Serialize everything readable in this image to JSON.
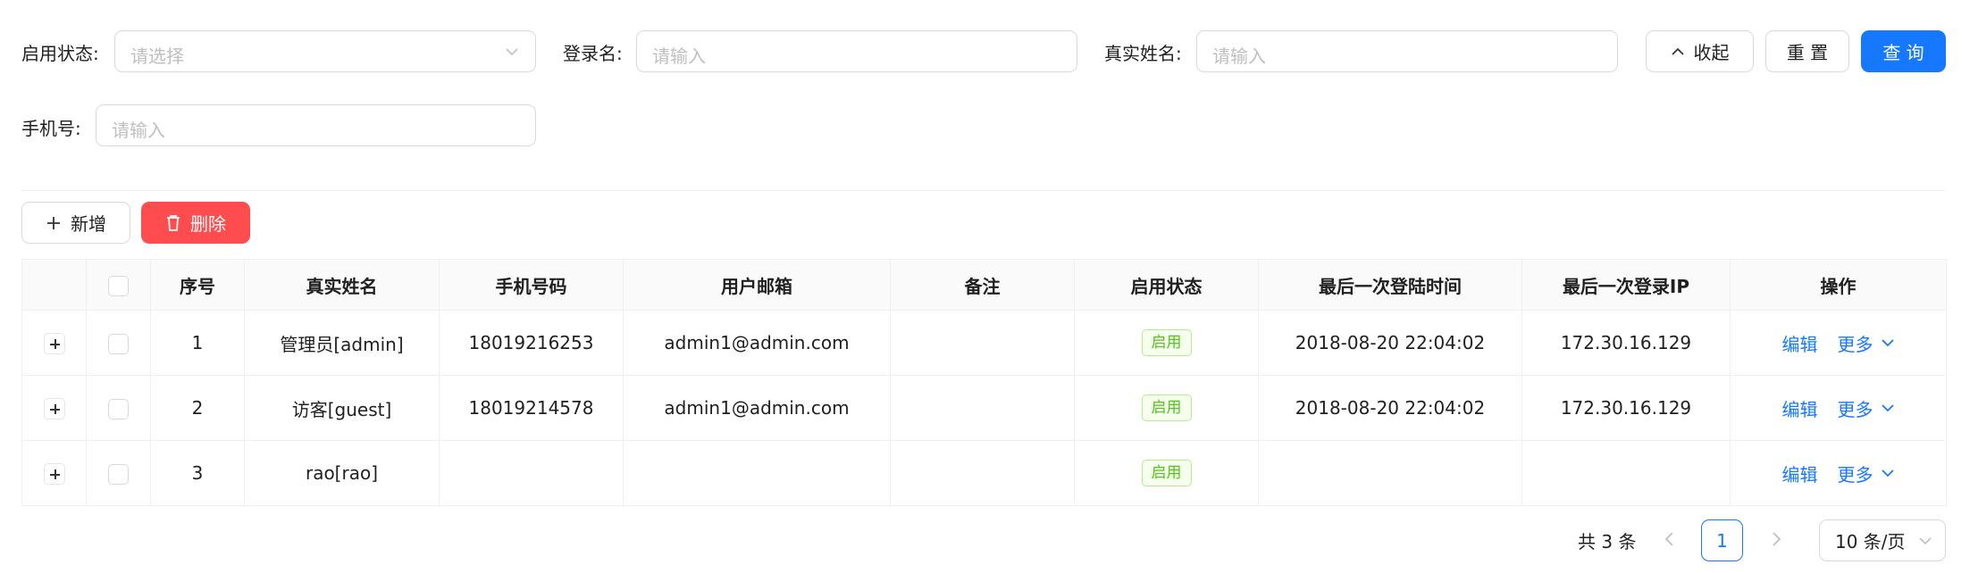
{
  "search": {
    "status_label": "启用状态",
    "status_placeholder": "请选择",
    "login_label": "登录名",
    "login_placeholder": "请输入",
    "realname_label": "真实姓名",
    "realname_placeholder": "请输入",
    "phone_label": "手机号",
    "phone_placeholder": "请输入",
    "colon": ":",
    "collapse_label": "收起",
    "reset_label": "重 置",
    "query_label": "查 询"
  },
  "toolbar": {
    "add_label": "新增",
    "delete_label": "删除"
  },
  "table": {
    "headers": [
      "序号",
      "真实姓名",
      "手机号码",
      "用户邮箱",
      "备注",
      "启用状态",
      "最后一次登陆时间",
      "最后一次登录IP",
      "操作"
    ],
    "rows": [
      {
        "index": "1",
        "name": "管理员[admin]",
        "phone": "18019216253",
        "email": "admin1@admin.com",
        "remark": "",
        "status": "启用",
        "last_login": "2018-08-20 22:04:02",
        "ip": "172.30.16.129",
        "edit": "编辑",
        "more": "更多"
      },
      {
        "index": "2",
        "name": "访客[guest]",
        "phone": "18019214578",
        "email": "admin1@admin.com",
        "remark": "",
        "status": "启用",
        "last_login": "2018-08-20 22:04:02",
        "ip": "172.30.16.129",
        "edit": "编辑",
        "more": "更多"
      },
      {
        "index": "3",
        "name": "rao[rao]",
        "phone": "",
        "email": "",
        "remark": "",
        "status": "启用",
        "last_login": "",
        "ip": "",
        "edit": "编辑",
        "more": "更多"
      }
    ]
  },
  "pagination": {
    "total_text": "共 3 条",
    "current_page": "1",
    "page_size": "10 条/页"
  },
  "colors": {
    "primary": "#1677ff",
    "danger": "#ff4d4f",
    "success": "#52c41a"
  }
}
